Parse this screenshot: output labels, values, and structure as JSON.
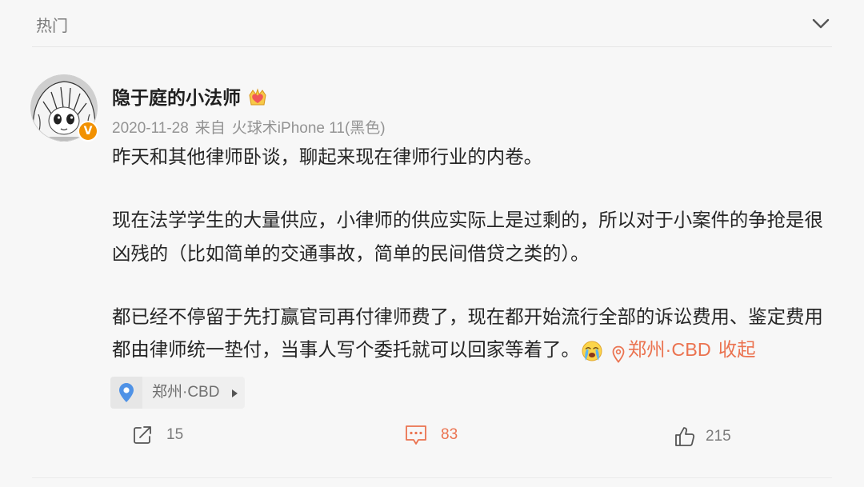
{
  "header": {
    "title": "热门",
    "toggle_icon": "chevron-down-icon"
  },
  "post": {
    "author": {
      "name": "隐于庭的小法师",
      "verified_badge": "V",
      "member_icon": "crown-heart-icon"
    },
    "meta": {
      "date": "2020-11-28",
      "source_prefix": "来自",
      "source": "火球术iPhone 11(黑色)"
    },
    "body": {
      "paragraphs": [
        [
          "昨天和其他律师卧谈，聊起来现在律师行业的内卷。"
        ],
        [
          "现在法学学生的大量供应，小律师的供应实际上是过剩的，所以对于小案件的争抢是很",
          "凶残的（比如简单的交通事故，简单的民间借贷之类的）。"
        ],
        [
          "都已经不停留于先打赢官司再付律师费了，现在都开始流行全部的诉讼费用、鉴定费用",
          "都由律师统一垫付，当事人写个委托就可以回家等着了。"
        ]
      ],
      "inline_emoji_icon": "crying-face-icon",
      "location_link_icon": "map-pin-icon",
      "location_link": "郑州·CBD",
      "collapse_label": "收起"
    },
    "location_chip": {
      "icon": "map-pin-icon",
      "label": "郑州·CBD",
      "arrow_icon": "caret-right-icon"
    },
    "actions": {
      "repost": {
        "icon": "share-icon",
        "count": "15"
      },
      "comment": {
        "icon": "comment-icon",
        "count": "83"
      },
      "like": {
        "icon": "thumbs-up-icon",
        "count": "215"
      }
    }
  },
  "colors": {
    "background": "#f7f7f7",
    "text": "#262626",
    "muted": "#939393",
    "accent_orange": "#eb7350",
    "verified_badge": "#f29100",
    "map_pin_blue": "#4f92e6"
  }
}
